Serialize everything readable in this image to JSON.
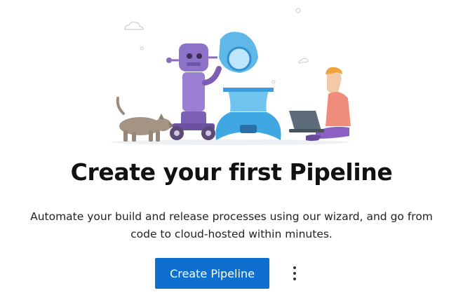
{
  "empty_state": {
    "title": "Create your first Pipeline",
    "description_line1": "Automate your build and release processes using our wizard, and go from",
    "description_line2": "code to cloud-hosted within minutes."
  },
  "actions": {
    "create_label": "Create Pipeline",
    "more_icon": "more-vertical-icon"
  },
  "colors": {
    "primary_button": "#0f6fce",
    "title_text": "#111111",
    "body_text": "#222222"
  }
}
